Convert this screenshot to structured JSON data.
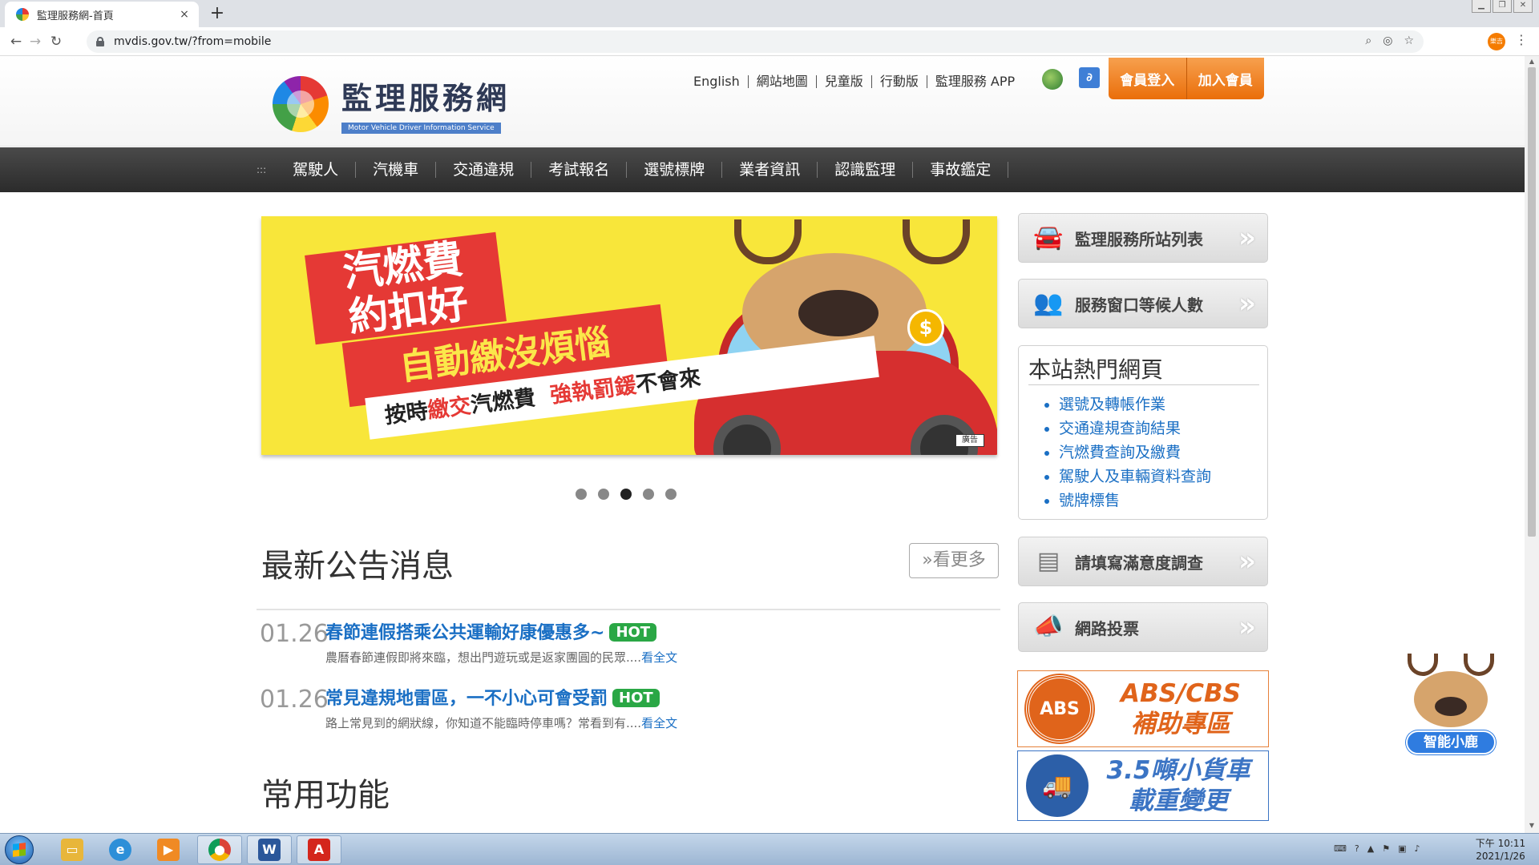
{
  "browser": {
    "tab_title": "監理服務網-首頁",
    "tab_close": "×",
    "new_tab": "+",
    "url": "mvdis.gov.tw/?from=mobile",
    "profile_initials": "樂吉",
    "window_controls": [
      "▁",
      "❐",
      "✕"
    ]
  },
  "header": {
    "logo_title": "監理服務網",
    "logo_subtitle": "Motor Vehicle Driver Information Service",
    "top_links": [
      "English",
      "網站地圖",
      "兒童版",
      "行動版",
      "監理服務 APP"
    ],
    "member_login": "會員登入",
    "member_join": "加入會員"
  },
  "main_nav": {
    "grip": ":::",
    "items": [
      "駕駛人",
      "汽機車",
      "交通違規",
      "考試報名",
      "選號標牌",
      "業者資訊",
      "認識監理",
      "事故鑑定"
    ]
  },
  "banner": {
    "line1": "汽燃費",
    "line2": "約扣好",
    "line3": "自動繳沒煩惱",
    "strip_a": "按時",
    "strip_b": "繳交",
    "strip_c": "汽燃費",
    "strip_d": "強執罰鍰",
    "strip_e": "不會來",
    "coin": "$",
    "ad_badge": "廣告",
    "slide_count": 5,
    "active_slide": 3
  },
  "news": {
    "title": "最新公告消息",
    "more": "»看更多",
    "items": [
      {
        "date": "01.26",
        "headline": "春節連假搭乘公共運輸好康優惠多~",
        "badge": "HOT",
        "summary": "農曆春節連假即將來臨，想出門遊玩或是返家團圓的民眾....",
        "read_more": "看全文"
      },
      {
        "date": "01.26",
        "headline": "常見違規地雷區，一不小心可會受罰",
        "badge": "HOT",
        "summary": "路上常見到的網狀線，你知道不能臨時停車嗎？常看到有....",
        "read_more": "看全文"
      }
    ]
  },
  "common": {
    "title": "常用功能"
  },
  "sidebar": {
    "btn_offices": "監理服務所站列表",
    "btn_queue": "服務窗口等候人數",
    "hot_title": "本站熱門網頁",
    "hot_links": [
      "選號及轉帳作業",
      "交通違規查詢結果",
      "汽燃費查詢及繳費",
      "駕駛人及車輛資料查詢",
      "號牌標售"
    ],
    "btn_survey": "請填寫滿意度調查",
    "btn_vote": "網路投票",
    "arrow": "»",
    "abs_circle": "ABS",
    "abs_line1": "ABS/CBS",
    "abs_line2": "補助專區",
    "truck_line1": "3.5噸小貨車",
    "truck_line2": "載重變更",
    "bot_label": "智能小鹿"
  },
  "taskbar": {
    "clock_line1": "下午 10:11",
    "clock_line2": "2021/1/26"
  },
  "colors": {
    "accent_orange": "#ea6e0a",
    "link_blue": "#1a6fc4",
    "hot_green": "#2aa745",
    "nav_dark": "#2b2b2b",
    "banner_yellow": "#f8e63a"
  }
}
